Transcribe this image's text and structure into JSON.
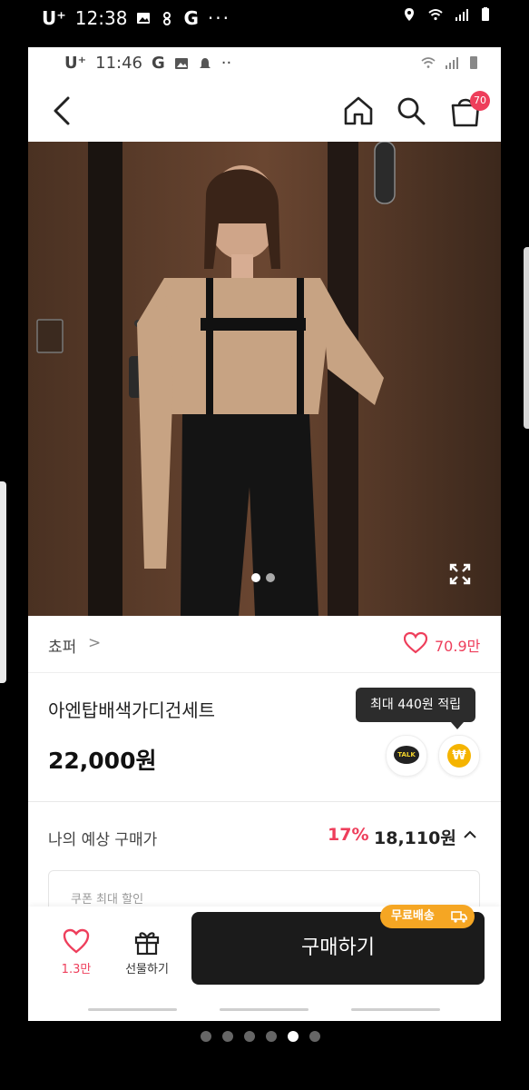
{
  "outer_status": {
    "carrier": "U⁺",
    "time": "12:38",
    "icons": [
      "image-icon",
      "thumb-icon",
      "google-g-icon",
      "more-dots-icon"
    ],
    "right_icons": [
      "location-icon",
      "wifi-icon",
      "signal-icon",
      "battery-icon"
    ]
  },
  "inner_status": {
    "carrier": "U⁺",
    "time": "11:46",
    "g_letter": "G",
    "more": "··"
  },
  "nav": {
    "cart_badge": "70"
  },
  "product": {
    "image_pages": 2,
    "active_image": 1,
    "shop_name": "쵸퍼",
    "shop_chevron": ">",
    "like_count": "70.9만",
    "title": "아엔탑배색가디건세트",
    "price": "22,000원",
    "tooltip": "최대 440원 적립",
    "talk_label": "TALK",
    "coin_label": "₩"
  },
  "estimate": {
    "label": "나의 예상 구매가",
    "discount": "17%",
    "price": "18,110원",
    "coupon_text": "쿠폰 최대 할인"
  },
  "bottom_bar": {
    "wish_count": "1.3만",
    "gift_label": "선물하기",
    "buy_label": "구매하기",
    "free_ship_label": "무료배송"
  },
  "viewer": {
    "pages": 6,
    "active_page": 5
  },
  "colors": {
    "accent": "#ee3e5b",
    "buy_button": "#1b1b1b",
    "free_ship": "#f5a623",
    "coin": "#f5b400"
  }
}
